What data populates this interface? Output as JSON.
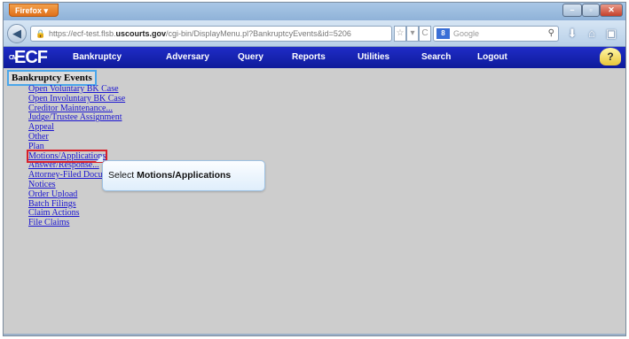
{
  "browser": {
    "app_button": "Firefox",
    "url_prefix": "https://ecf-test.flsb.",
    "url_domain": "uscourts.gov",
    "url_path": "/cgi-bin/DisplayMenu.pl?BankruptcyEvents&id=5206",
    "search_placeholder": "Google",
    "search_engine_badge": "8"
  },
  "ecf": {
    "logo": "ECF",
    "logo_prefix": "CM",
    "menu": [
      "Bankruptcy",
      "Adversary",
      "Query",
      "Reports",
      "Utilities",
      "Search",
      "Logout"
    ]
  },
  "page": {
    "heading": "Bankruptcy Events",
    "events": [
      "Open Voluntary BK Case",
      "Open Involuntary BK Case",
      "Creditor Maintenance...",
      "Judge/Trustee Assignment",
      "Appeal",
      "Other",
      "Plan",
      "Motions/Applications",
      "Answer/Response...",
      "Attorney-Filed Documents",
      "Notices",
      "Order Upload",
      "Batch Filings",
      "Claim Actions",
      "File Claims"
    ]
  },
  "callout": {
    "prefix": "Select ",
    "target": "Motions/Applications"
  },
  "colors": {
    "ecf_bar": "#1f2cc7",
    "link": "#1a14d0",
    "highlight": "#d8202a",
    "heading_border": "#4aa6ea"
  }
}
